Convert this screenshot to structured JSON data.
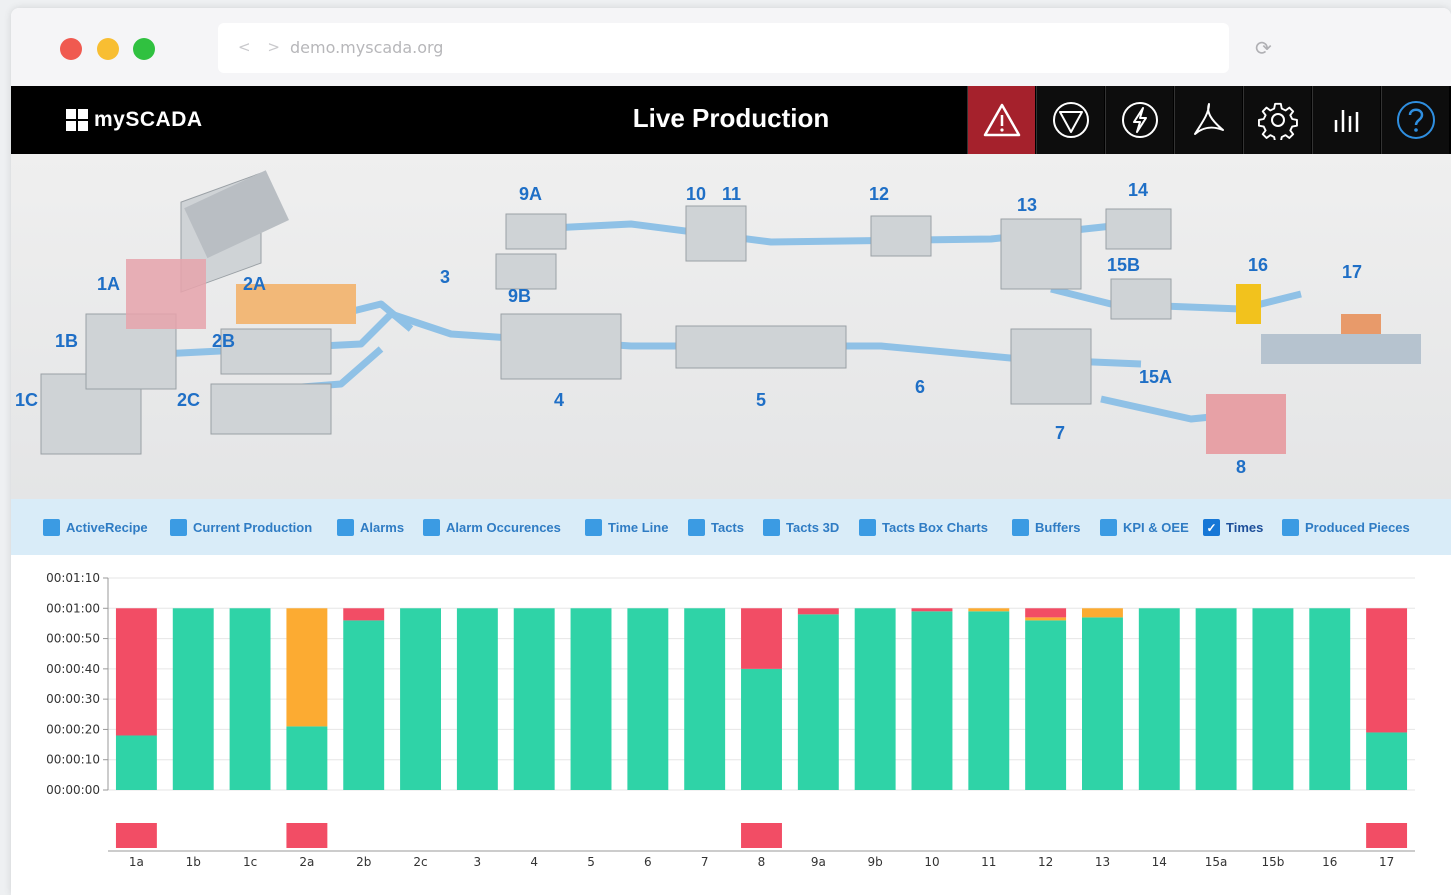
{
  "browser": {
    "url": "demo.myscada.org",
    "nav": "< >"
  },
  "app": {
    "logo_text": "mySCADA",
    "title": "Live Production"
  },
  "toolbar": {
    "items": [
      "warning-icon",
      "stop-icon",
      "power-icon",
      "pdf-icon",
      "settings-icon",
      "chart-icon",
      "help-icon"
    ]
  },
  "scene": {
    "labels": [
      "9A",
      "10",
      "11",
      "12",
      "13",
      "14",
      "1A",
      "2A",
      "3",
      "9B",
      "15B",
      "16",
      "17",
      "1B",
      "2B",
      "1C",
      "2C",
      "4",
      "5",
      "6",
      "15A",
      "7",
      "8"
    ]
  },
  "legend": [
    {
      "label": "ActiveRecipe",
      "checked": false
    },
    {
      "label": "Current Production",
      "checked": false
    },
    {
      "label": "Alarms",
      "checked": false
    },
    {
      "label": "Alarm Occurences",
      "checked": false
    },
    {
      "label": "Time Line",
      "checked": false
    },
    {
      "label": "Tacts",
      "checked": false
    },
    {
      "label": "Tacts 3D",
      "checked": false
    },
    {
      "label": "Tacts Box Charts",
      "checked": false
    },
    {
      "label": "Buffers",
      "checked": false
    },
    {
      "label": "KPI & OEE",
      "checked": false
    },
    {
      "label": "Times",
      "checked": true
    },
    {
      "label": "Produced Pieces",
      "checked": false
    }
  ],
  "colors": {
    "green": "#2fd3a7",
    "red": "#f24d65",
    "orange": "#fcab32"
  },
  "chart_data": {
    "type": "bar",
    "stacked": true,
    "categories": [
      "1a",
      "1b",
      "1c",
      "2a",
      "2b",
      "2c",
      "3",
      "4",
      "5",
      "6",
      "7",
      "8",
      "9a",
      "9b",
      "10",
      "11",
      "12",
      "13",
      "14",
      "15a",
      "15b",
      "16",
      "17"
    ],
    "y_ticks": [
      "00:00:00",
      "00:00:10",
      "00:00:20",
      "00:00:30",
      "00:00:40",
      "00:00:50",
      "00:01:00",
      "00:01:10"
    ],
    "ylim": [
      0,
      70
    ],
    "series": [
      {
        "color": "#2fd3a7",
        "values": [
          18,
          60,
          60,
          21,
          56,
          60,
          60,
          60,
          60,
          60,
          60,
          40,
          58,
          60,
          59,
          59,
          56,
          57,
          60,
          60,
          60,
          60,
          19
        ]
      },
      {
        "color": "#fcab32",
        "values": [
          0,
          0,
          0,
          39,
          0,
          0,
          0,
          0,
          0,
          0,
          0,
          0,
          0,
          0,
          0,
          1,
          1,
          3,
          0,
          0,
          0,
          0,
          0
        ]
      },
      {
        "color": "#f24d65",
        "values": [
          42,
          0,
          0,
          0,
          4,
          0,
          0,
          0,
          0,
          0,
          0,
          20,
          2,
          0,
          1,
          0,
          3,
          0,
          0,
          0,
          0,
          0,
          41
        ]
      }
    ],
    "alarm_strip": [
      1,
      0,
      0,
      1,
      0,
      0,
      0,
      0,
      0,
      0,
      0,
      1,
      0,
      0,
      0,
      0,
      0,
      0,
      0,
      0,
      0,
      0,
      1
    ],
    "grid": true
  }
}
